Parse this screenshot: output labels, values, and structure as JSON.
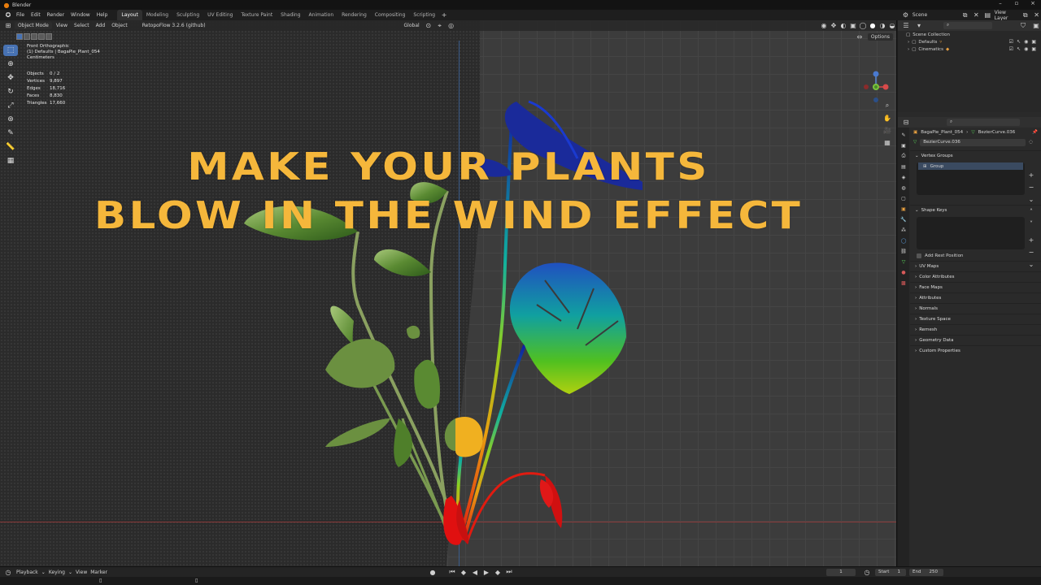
{
  "window": {
    "title": "Blender"
  },
  "menu": [
    "File",
    "Edit",
    "Render",
    "Window",
    "Help"
  ],
  "workspaces": [
    "Layout",
    "Modeling",
    "Sculpting",
    "UV Editing",
    "Texture Paint",
    "Shading",
    "Animation",
    "Rendering",
    "Compositing",
    "Scripting"
  ],
  "active_workspace": "Layout",
  "viewport_header": {
    "mode": "Object Mode",
    "items": [
      "View",
      "Select",
      "Add",
      "Object"
    ],
    "addon": "RetopoFlow 3.2.6 (github)",
    "orientation": "Global",
    "options": "Options"
  },
  "viewport_overlay": {
    "view_name": "Front Orthographic",
    "collection_path": "(1) Defaults | BagaPie_Plant_054",
    "units": "Centimeters"
  },
  "stats": [
    {
      "label": "Objects",
      "value": "0 / 2"
    },
    {
      "label": "Vertices",
      "value": "9,897"
    },
    {
      "label": "Edges",
      "value": "18,716"
    },
    {
      "label": "Faces",
      "value": "8,830"
    },
    {
      "label": "Triangles",
      "value": "17,660"
    }
  ],
  "headline": {
    "line1": "MAKE YOUR PLANTS",
    "line2": "BLOW IN THE WIND EFFECT"
  },
  "scene": {
    "label": "Scene",
    "view_layer": "View Layer"
  },
  "outliner": {
    "root": "Scene Collection",
    "items": [
      "Defaults",
      "Cinematics"
    ]
  },
  "properties": {
    "object": "BagaPie_Plant_054",
    "data": "BezierCurve.036",
    "mesh_name": "BezierCurve.036",
    "sections": {
      "vertex_groups": "Vertex Groups",
      "group_item": "Group",
      "shape_keys": "Shape Keys",
      "add_rest_position": "Add Rest Position"
    },
    "collapsed": [
      "UV Maps",
      "Color Attributes",
      "Face Maps",
      "Attributes",
      "Normals",
      "Texture Space",
      "Remesh",
      "Geometry Data",
      "Custom Properties"
    ]
  },
  "timeline": {
    "menus": [
      "Playback",
      "Keying",
      "View",
      "Marker"
    ],
    "current_frame": "1",
    "start_label": "Start",
    "start": "1",
    "end_label": "End",
    "end": "250"
  },
  "colors": {
    "headline": "#f5b73b",
    "accent": "#4772b3"
  }
}
